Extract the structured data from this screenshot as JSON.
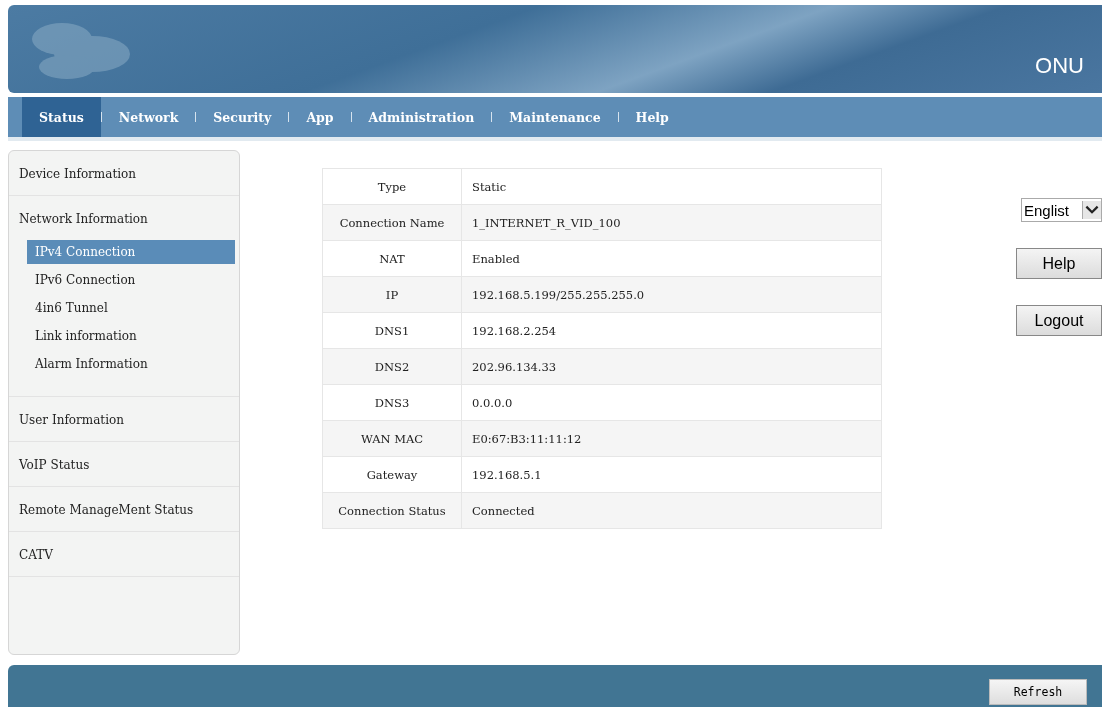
{
  "header": {
    "product": "ONU"
  },
  "tabs": [
    {
      "label": "Status",
      "selected": true
    },
    {
      "label": "Network",
      "selected": false
    },
    {
      "label": "Security",
      "selected": false
    },
    {
      "label": "App",
      "selected": false
    },
    {
      "label": "Administration",
      "selected": false
    },
    {
      "label": "Maintenance",
      "selected": false
    },
    {
      "label": "Help",
      "selected": false
    }
  ],
  "sidebar": {
    "items": [
      {
        "label": "Device Information",
        "selected": false
      },
      {
        "label": "Network Information",
        "selected": false,
        "children": [
          {
            "label": "IPv4 Connection",
            "selected": true
          },
          {
            "label": "IPv6 Connection",
            "selected": false
          },
          {
            "label": "4in6 Tunnel",
            "selected": false
          },
          {
            "label": "Link information",
            "selected": false
          },
          {
            "label": "Alarm Information",
            "selected": false
          }
        ]
      },
      {
        "label": "User Information",
        "selected": false
      },
      {
        "label": "VoIP Status",
        "selected": false
      },
      {
        "label": "Remote ManageMent Status",
        "selected": false
      },
      {
        "label": "CATV",
        "selected": false
      }
    ]
  },
  "table": {
    "rows": [
      {
        "label": "Type",
        "value": "Static"
      },
      {
        "label": "Connection Name",
        "value": "1_INTERNET_R_VID_100"
      },
      {
        "label": "NAT",
        "value": "Enabled"
      },
      {
        "label": "IP",
        "value": "192.168.5.199/255.255.255.0"
      },
      {
        "label": "DNS1",
        "value": "192.168.2.254"
      },
      {
        "label": "DNS2",
        "value": "202.96.134.33"
      },
      {
        "label": "DNS3",
        "value": "0.0.0.0"
      },
      {
        "label": "WAN MAC",
        "value": "E0:67:B3:11:11:12"
      },
      {
        "label": "Gateway",
        "value": "192.168.5.1"
      },
      {
        "label": "Connection Status",
        "value": "Connected"
      }
    ]
  },
  "language": {
    "value": "Englist"
  },
  "buttons": [
    "Help",
    "Logout"
  ],
  "footer": {
    "button": "Refresh"
  }
}
